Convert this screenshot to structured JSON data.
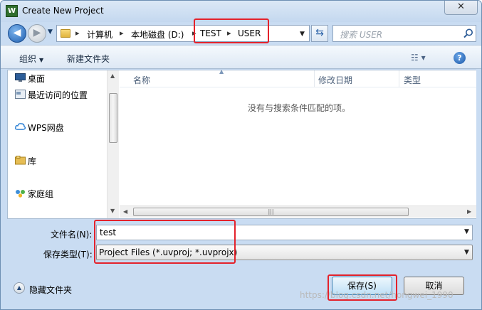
{
  "window": {
    "title": "Create New Project",
    "app_icon_glyph": "W",
    "close_glyph": "✕"
  },
  "address_bar": {
    "crumbs": [
      "计算机",
      "本地磁盘 (D:)",
      "TEST",
      "USER"
    ],
    "separator": "▸"
  },
  "search": {
    "placeholder": "搜索 USER"
  },
  "toolbar": {
    "organize_label": "组织",
    "new_folder_label": "新建文件夹",
    "view_glyph": "☷ ▾",
    "help_glyph": "?"
  },
  "nav_pane": {
    "items": [
      {
        "label": "桌面",
        "icon": "desktop-icon"
      },
      {
        "label": "最近访问的位置",
        "icon": "recent-places-icon"
      },
      {
        "label": "WPS网盘",
        "icon": "cloud-icon"
      },
      {
        "label": "库",
        "icon": "library-icon"
      },
      {
        "label": "家庭组",
        "icon": "homegroup-icon"
      }
    ]
  },
  "file_list": {
    "columns": [
      "名称",
      "修改日期",
      "类型"
    ],
    "empty_message": "没有与搜索条件匹配的项。"
  },
  "form": {
    "filename_label": "文件名(N):",
    "filename_value": "test",
    "filetype_label": "保存类型(T):",
    "filetype_value": "Project Files (*.uvproj; *.uvprojx)"
  },
  "footer": {
    "hide_folders_label": "隐藏文件夹",
    "save_label": "保存(S)",
    "cancel_label": "取消"
  },
  "watermark": "https://blog.csdn.net/hongwei_1990",
  "colors": {
    "annotation_red": "#e4222b",
    "title_bar": "#c9dcf2"
  }
}
